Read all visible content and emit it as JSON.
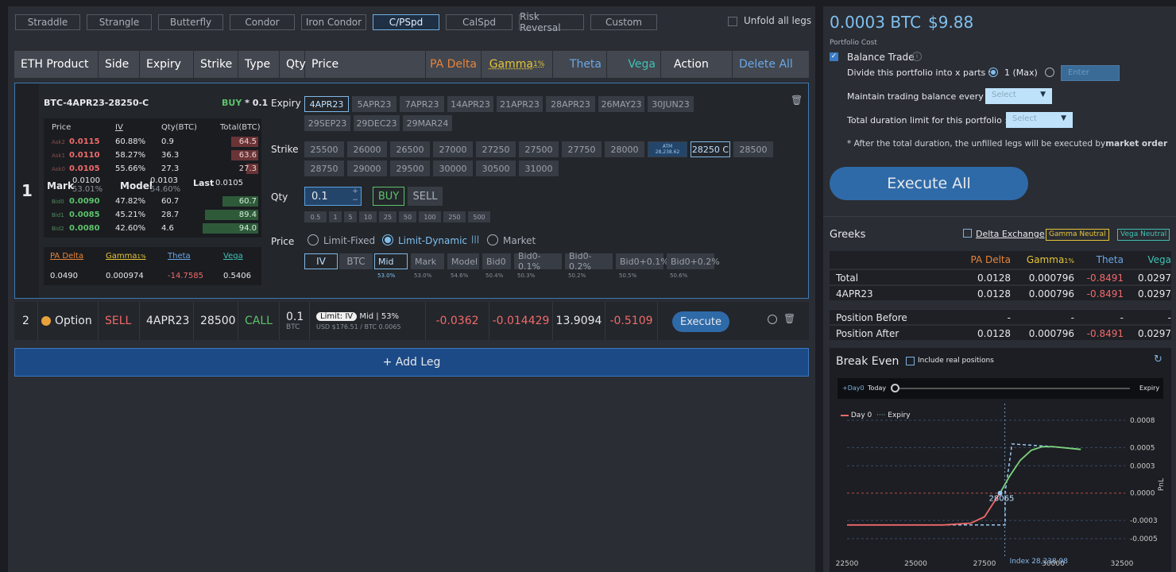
{
  "strategies": [
    "Straddle",
    "Strangle",
    "Butterfly",
    "Condor",
    "Iron Condor",
    "C/PSpd",
    "CalSpd",
    "Risk Reversal",
    "Custom"
  ],
  "unfold_label": "Unfold all legs",
  "table_header": {
    "product": "ETH Product",
    "side": "Side",
    "expiry": "Expiry",
    "strike": "Strike",
    "type": "Type",
    "qty": "Qty",
    "price": "Price",
    "pa_delta": "PA Delta",
    "gamma": "Gamma",
    "gamma_sub": "1%",
    "theta": "Theta",
    "vega": "Vega",
    "action": "Action",
    "delete_all": "Delete All"
  },
  "leg1": {
    "index": "1",
    "instrument": "BTC-4APR23-28250-C",
    "side_label": "BUY",
    "side_qty": "* 0.1",
    "ob_header": {
      "price": "Price",
      "iv": "IV",
      "qty": "Qty(BTC)",
      "total": "Total(BTC)"
    },
    "asks": [
      {
        "label": "Ask2",
        "price": "0.0115",
        "iv": "60.88%",
        "qty": "0.9",
        "total": "64.5"
      },
      {
        "label": "Ask1",
        "price": "0.0110",
        "iv": "58.27%",
        "qty": "36.3",
        "total": "63.6"
      },
      {
        "label": "Ask0",
        "price": "0.0105",
        "iv": "55.66%",
        "qty": "27.3",
        "total": "27.3"
      }
    ],
    "mark_label": "Mark",
    "mark_value": "0.0100",
    "mark_iv": "53.01%",
    "model_label": "Model",
    "model_value": "0.0103",
    "model_iv": "54.60%",
    "last_label": "Last",
    "last_value": "0.0105",
    "bids": [
      {
        "label": "Bid0",
        "price": "0.0090",
        "iv": "47.82%",
        "qty": "60.7",
        "total": "60.7"
      },
      {
        "label": "Bid1",
        "price": "0.0085",
        "iv": "45.21%",
        "qty": "28.7",
        "total": "89.4"
      },
      {
        "label": "Bid2",
        "price": "0.0080",
        "iv": "42.60%",
        "qty": "4.6",
        "total": "94.0"
      }
    ],
    "greeks_header": {
      "pa_delta": "PA Delta",
      "gamma": "Gamma",
      "gamma_sub": "1%",
      "theta": "Theta",
      "vega": "Vega"
    },
    "greeks": {
      "pa_delta": "0.0490",
      "gamma": "0.000974",
      "theta": "-14.7585",
      "vega": "0.5406"
    },
    "expiry_label": "Expiry",
    "expiries": [
      "4APR23",
      "5APR23",
      "7APR23",
      "14APR23",
      "21APR23",
      "28APR23",
      "26MAY23",
      "30JUN23",
      "29SEP23",
      "29DEC23",
      "29MAR24"
    ],
    "strike_label": "Strike",
    "strikes_row1": [
      "25500",
      "26000",
      "26500",
      "27000",
      "27250",
      "27500",
      "27750",
      "28000"
    ],
    "atm_label": "ATM",
    "atm_value": "28,238.62",
    "strike_selected": "28250 C",
    "strike_after": "28500",
    "strikes_row2": [
      "28750",
      "29000",
      "29500",
      "30000",
      "30500",
      "31000"
    ],
    "qty_label": "Qty",
    "qty_value": "0.1",
    "buy_label": "BUY",
    "sell_label": "SELL",
    "qty_presets": [
      "0.5",
      "1",
      "5",
      "10",
      "25",
      "50",
      "100",
      "250",
      "500"
    ],
    "price_label": "Price",
    "price_modes": [
      "Limit-Fixed",
      "Limit-Dynamic",
      "Market"
    ],
    "price_basis": [
      "IV",
      "BTC"
    ],
    "price_refs": [
      {
        "label": "Mid",
        "pct": "53.0%"
      },
      {
        "label": "Mark",
        "pct": "53.0%"
      },
      {
        "label": "Model",
        "pct": "54.6%"
      },
      {
        "label": "Bid0",
        "pct": "50.4%"
      },
      {
        "label": "Bid0-0.1%",
        "pct": "50.3%"
      },
      {
        "label": "Bid0-0.2%",
        "pct": "50.2%"
      },
      {
        "label": "Bid0+0.1%",
        "pct": "50.5%"
      },
      {
        "label": "Bid0+0.2%",
        "pct": "50.6%"
      }
    ]
  },
  "leg2": {
    "index": "2",
    "product": "Option",
    "side": "SELL",
    "expiry": "4APR23",
    "strike": "28500",
    "type": "CALL",
    "qty": "0.1",
    "qty_unit": "BTC",
    "limit_tag": "Limit: IV",
    "mid_label": "Mid",
    "mid_pct": "53%",
    "price_sub": "USD $176.51 / BTC 0.0065",
    "pa_delta": "-0.0362",
    "gamma": "-0.014429",
    "theta": "13.9094",
    "vega": "-0.5109",
    "execute": "Execute"
  },
  "add_leg": "+ Add Leg",
  "portfolio": {
    "cost_btc": "0.0003 BTC",
    "cost_usd": "$9.88",
    "cost_label": "Portfolio Cost",
    "balance_trade": "Balance Trade",
    "divide_label": "Divide this portfolio into x parts :",
    "divide_max": "1 (Max)",
    "divide_placeholder": "Enter",
    "maintain_label": "Maintain trading balance every :",
    "duration_label": "Total duration limit for this portfolio :",
    "select_placeholder": "Select",
    "note": "* After the total duration, the unfilled legs will be executed by",
    "note_bold": "market order",
    "execute_all": "Execute All"
  },
  "greeks_panel": {
    "title": "Greeks",
    "delta_exchange": "Delta Exchange",
    "gamma_neutral": "Gamma Neutral",
    "vega_neutral": "Vega Neutral",
    "headers": [
      "PA Delta",
      "Gamma",
      "Theta",
      "Vega"
    ],
    "gamma_sub": "1%",
    "rows": [
      {
        "label": "Total",
        "v": [
          "0.0128",
          "0.000796",
          "-0.8491",
          "0.0297"
        ]
      },
      {
        "label": "4APR23",
        "v": [
          "0.0128",
          "0.000796",
          "-0.8491",
          "0.0297"
        ]
      },
      {
        "label": "Position Before",
        "v": [
          "-",
          "-",
          "-",
          "-"
        ]
      },
      {
        "label": "Position After",
        "v": [
          "0.0128",
          "0.000796",
          "-0.8491",
          "0.0297"
        ]
      }
    ]
  },
  "break_even": {
    "title": "Break Even",
    "include_real": "Include real positions",
    "slider_left": "+Day0",
    "slider_today": "Today",
    "slider_right": "Expiry",
    "legend_day0": "Day 0",
    "legend_expiry": "Expiry",
    "be_label": "28065",
    "index_label": "Index 28,238.98",
    "ylabel": "PnL"
  },
  "chart_data": {
    "type": "line",
    "xlabel": "",
    "ylabel": "PnL",
    "x_ticks": [
      22500,
      25000,
      27500,
      30000,
      32500
    ],
    "y_ticks": [
      0.0008,
      0.0005,
      0.0003,
      0.0,
      -0.0003,
      -0.0005
    ],
    "y_tick_labels": [
      "0.0008",
      "0.0005",
      "0.0003",
      "0.0000",
      "-0.0003",
      "-0.0005"
    ],
    "xlim": [
      22500,
      32500
    ],
    "ylim": [
      -0.0005,
      0.0008
    ],
    "series": [
      {
        "name": "Day 0",
        "style": "solid",
        "points": [
          [
            22500,
            -0.00035
          ],
          [
            26000,
            -0.00035
          ],
          [
            27000,
            -0.00033
          ],
          [
            27500,
            -0.00026
          ],
          [
            27800,
            -0.00012
          ],
          [
            28065,
            0.0
          ],
          [
            28400,
            0.00018
          ],
          [
            28800,
            0.00036
          ],
          [
            29200,
            0.00047
          ],
          [
            29600,
            0.00051
          ],
          [
            30000,
            0.00051
          ],
          [
            31000,
            0.00048
          ]
        ]
      },
      {
        "name": "Expiry",
        "style": "dashed",
        "points": [
          [
            22500,
            -0.00035
          ],
          [
            28250,
            -0.00035
          ],
          [
            28250,
            0.0
          ],
          [
            28500,
            0.00054
          ],
          [
            30000,
            0.00051
          ],
          [
            31000,
            0.00048
          ]
        ]
      }
    ],
    "markers": [
      {
        "x": 28065,
        "y": 0,
        "label": "28065"
      }
    ],
    "index_line": 28238.98
  }
}
